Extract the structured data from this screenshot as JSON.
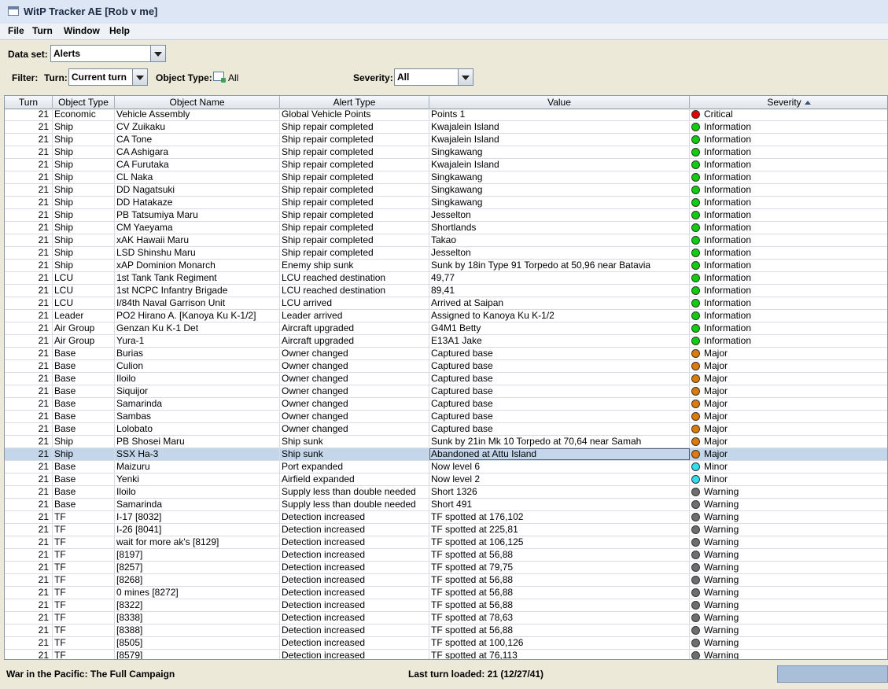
{
  "window": {
    "title": "WitP Tracker AE [Rob v me]"
  },
  "menu": [
    "File",
    "Turn",
    "Window",
    "Help"
  ],
  "dataset": {
    "label": "Data set:",
    "value": "Alerts"
  },
  "filter": {
    "label": "Filter:",
    "turn_label": "Turn:",
    "turn_value": "Current turn",
    "object_type_label": "Object Type:",
    "object_type_value": "All",
    "severity_label": "Severity:",
    "severity_value": "All"
  },
  "table": {
    "columns": [
      "Turn",
      "Object Type",
      "Object Name",
      "Alert Type",
      "Value",
      "Severity"
    ],
    "sorted_column": "Severity",
    "selected_row": 27,
    "severity_colors": {
      "Critical": "#e00000",
      "Information": "#11cc11",
      "Major": "#dd7a0c",
      "Minor": "#33ddee",
      "Warning": "#6e6e6e"
    },
    "rows": [
      [
        "21",
        "Economic",
        "Vehicle Assembly",
        "Global Vehicle Points",
        "Points 1",
        "Critical"
      ],
      [
        "21",
        "Ship",
        "CV Zuikaku",
        "Ship repair completed",
        "Kwajalein Island",
        "Information"
      ],
      [
        "21",
        "Ship",
        "CA Tone",
        "Ship repair completed",
        "Kwajalein Island",
        "Information"
      ],
      [
        "21",
        "Ship",
        "CA Ashigara",
        "Ship repair completed",
        "Singkawang",
        "Information"
      ],
      [
        "21",
        "Ship",
        "CA Furutaka",
        "Ship repair completed",
        "Kwajalein Island",
        "Information"
      ],
      [
        "21",
        "Ship",
        "CL Naka",
        "Ship repair completed",
        "Singkawang",
        "Information"
      ],
      [
        "21",
        "Ship",
        "DD Nagatsuki",
        "Ship repair completed",
        "Singkawang",
        "Information"
      ],
      [
        "21",
        "Ship",
        "DD Hatakaze",
        "Ship repair completed",
        "Singkawang",
        "Information"
      ],
      [
        "21",
        "Ship",
        "PB Tatsumiya Maru",
        "Ship repair completed",
        "Jesselton",
        "Information"
      ],
      [
        "21",
        "Ship",
        "CM Yaeyama",
        "Ship repair completed",
        "Shortlands",
        "Information"
      ],
      [
        "21",
        "Ship",
        "xAK Hawaii Maru",
        "Ship repair completed",
        "Takao",
        "Information"
      ],
      [
        "21",
        "Ship",
        "LSD Shinshu Maru",
        "Ship repair completed",
        "Jesselton",
        "Information"
      ],
      [
        "21",
        "Ship",
        "xAP Dominion Monarch",
        "Enemy ship sunk",
        "Sunk by 18in Type 91 Torpedo at 50,96 near Batavia",
        "Information"
      ],
      [
        "21",
        "LCU",
        "1st Tank Tank Regiment",
        "LCU reached destination",
        "49,77",
        "Information"
      ],
      [
        "21",
        "LCU",
        "1st NCPC Infantry Brigade",
        "LCU reached destination",
        "89,41",
        "Information"
      ],
      [
        "21",
        "LCU",
        "I/84th Naval Garrison Unit",
        "LCU arrived",
        "Arrived at Saipan",
        "Information"
      ],
      [
        "21",
        "Leader",
        "PO2 Hirano A. [Kanoya Ku K-1/2]",
        "Leader arrived",
        "Assigned to Kanoya Ku K-1/2",
        "Information"
      ],
      [
        "21",
        "Air Group",
        "Genzan Ku K-1 Det",
        "Aircraft upgraded",
        "G4M1 Betty",
        "Information"
      ],
      [
        "21",
        "Air Group",
        "Yura-1",
        "Aircraft upgraded",
        "E13A1 Jake",
        "Information"
      ],
      [
        "21",
        "Base",
        "Burias",
        "Owner changed",
        "Captured base",
        "Major"
      ],
      [
        "21",
        "Base",
        "Culion",
        "Owner changed",
        "Captured base",
        "Major"
      ],
      [
        "21",
        "Base",
        "Iloilo",
        "Owner changed",
        "Captured base",
        "Major"
      ],
      [
        "21",
        "Base",
        "Siquijor",
        "Owner changed",
        "Captured base",
        "Major"
      ],
      [
        "21",
        "Base",
        "Samarinda",
        "Owner changed",
        "Captured base",
        "Major"
      ],
      [
        "21",
        "Base",
        "Sambas",
        "Owner changed",
        "Captured base",
        "Major"
      ],
      [
        "21",
        "Base",
        "Lolobato",
        "Owner changed",
        "Captured base",
        "Major"
      ],
      [
        "21",
        "Ship",
        "PB Shosei Maru",
        "Ship sunk",
        "Sunk by 21in Mk 10 Torpedo at 70,64 near Samah",
        "Major"
      ],
      [
        "21",
        "Ship",
        "SSX Ha-3",
        "Ship sunk",
        "Abandoned at Attu Island",
        "Major"
      ],
      [
        "21",
        "Base",
        "Maizuru",
        "Port expanded",
        "Now level 6",
        "Minor"
      ],
      [
        "21",
        "Base",
        "Yenki",
        "Airfield expanded",
        "Now level 2",
        "Minor"
      ],
      [
        "21",
        "Base",
        "Iloilo",
        "Supply less than double needed",
        "Short 1326",
        "Warning"
      ],
      [
        "21",
        "Base",
        "Samarinda",
        "Supply less than double needed",
        "Short 491",
        "Warning"
      ],
      [
        "21",
        "TF",
        "I-17 [8032]",
        "Detection increased",
        "TF spotted at 176,102",
        "Warning"
      ],
      [
        "21",
        "TF",
        "I-26 [8041]",
        "Detection increased",
        "TF spotted at 225,81",
        "Warning"
      ],
      [
        "21",
        "TF",
        "wait for more ak's [8129]",
        "Detection increased",
        "TF spotted at 106,125",
        "Warning"
      ],
      [
        "21",
        "TF",
        "[8197]",
        "Detection increased",
        "TF spotted at 56,88",
        "Warning"
      ],
      [
        "21",
        "TF",
        "[8257]",
        "Detection increased",
        "TF spotted at 79,75",
        "Warning"
      ],
      [
        "21",
        "TF",
        "[8268]",
        "Detection increased",
        "TF spotted at 56,88",
        "Warning"
      ],
      [
        "21",
        "TF",
        "0 mines [8272]",
        "Detection increased",
        "TF spotted at 56,88",
        "Warning"
      ],
      [
        "21",
        "TF",
        "[8322]",
        "Detection increased",
        "TF spotted at 56,88",
        "Warning"
      ],
      [
        "21",
        "TF",
        "[8338]",
        "Detection increased",
        "TF spotted at 78,63",
        "Warning"
      ],
      [
        "21",
        "TF",
        "[8388]",
        "Detection increased",
        "TF spotted at 56,88",
        "Warning"
      ],
      [
        "21",
        "TF",
        "[8505]",
        "Detection increased",
        "TF spotted at 100,126",
        "Warning"
      ],
      [
        "21",
        "TF",
        "[8579]",
        "Detection increased",
        "TF spotted at 76,113",
        "Warning"
      ]
    ]
  },
  "status": {
    "left": "War in the Pacific: The Full Campaign",
    "center": "Last turn loaded: 21 (12/27/41)"
  }
}
